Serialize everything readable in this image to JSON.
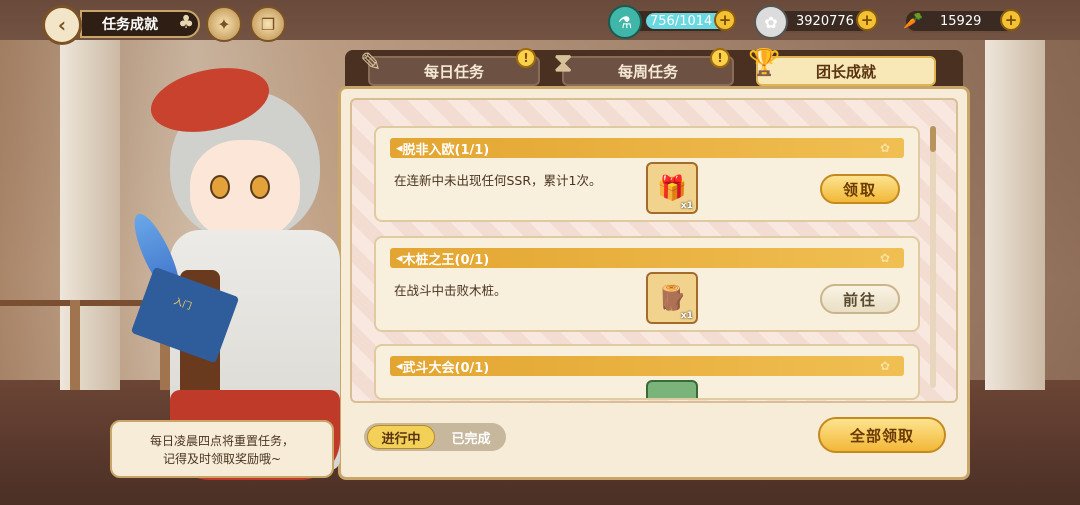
{
  "header": {
    "back_icon": "back-arrow-icon",
    "title": "任务成就",
    "buttons": [
      {
        "icon": "compass-badge-icon"
      },
      {
        "icon": "book-scroll-icon"
      }
    ]
  },
  "resources": [
    {
      "icon": "potion-icon",
      "value": "756/1014",
      "fill": 0.75
    },
    {
      "icon": "gem-icon",
      "value": "3920776"
    },
    {
      "icon": "carrot-icon",
      "value": "15929"
    }
  ],
  "tabs": [
    {
      "label": "每日任务",
      "icon": "book-icon",
      "badge": "!",
      "active": false
    },
    {
      "label": "每周任务",
      "icon": "hourglass-icon",
      "badge": "!",
      "active": false
    },
    {
      "label": "团长成就",
      "icon": "trophy-icon",
      "active": true
    }
  ],
  "achievements": [
    {
      "title": "脱非入欧(1/1)",
      "desc": "在连新中未出现任何SSR，累计1次。",
      "reward_icon": "gift-box-icon",
      "reward_qty": "x1",
      "button": "领取",
      "state": "claim"
    },
    {
      "title": "木桩之王(0/1)",
      "desc": "在战斗中击败木桩。",
      "reward_icon": "wooden-dummy-icon",
      "reward_qty": "x1",
      "button": "前往",
      "state": "go"
    },
    {
      "title": "武斗大会(0/1)",
      "desc": "",
      "reward_icon": "green-item-icon",
      "reward_qty": "",
      "button": "",
      "state": "partial"
    }
  ],
  "filter": {
    "in_progress": "进行中",
    "completed": "已完成"
  },
  "claim_all": "全部领取",
  "tip": {
    "line1": "每日凌晨四点将重置任务，",
    "line2": "记得及时领取奖励哦~"
  },
  "book_text": "入门"
}
